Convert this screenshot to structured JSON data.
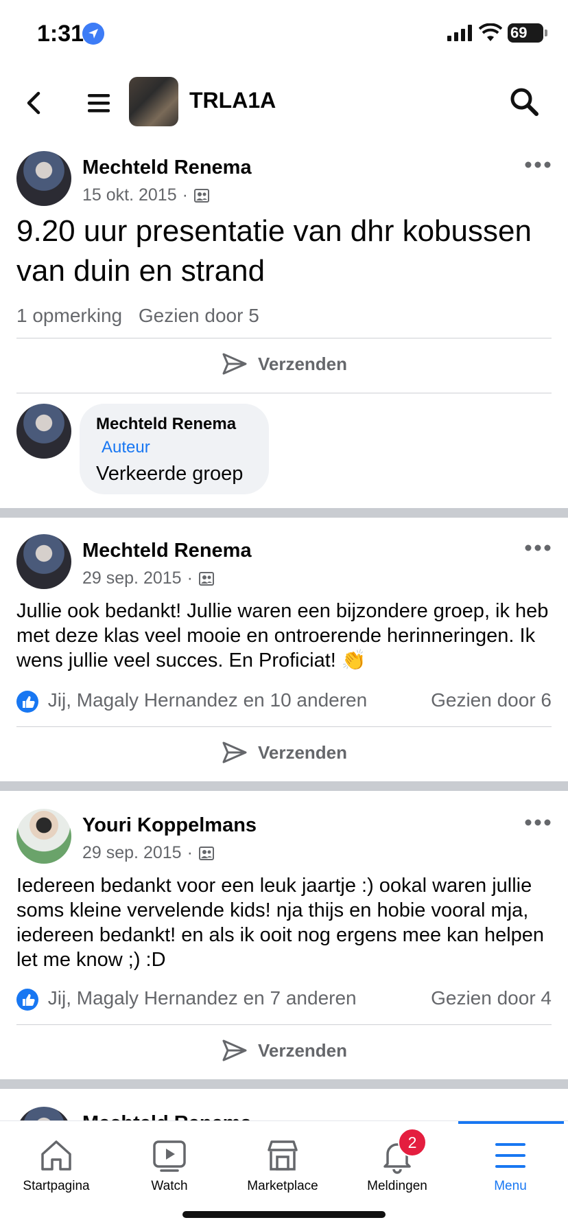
{
  "status_bar": {
    "time": "1:31",
    "battery": "69"
  },
  "header": {
    "title": "TRLA1A"
  },
  "posts": [
    {
      "author": "Mechteld Renema",
      "date": "15 okt. 2015",
      "dot": "·",
      "body": "9.20 uur presentatie van dhr kobussen van duin en strand",
      "comments": "1 opmerking",
      "seen": "Gezien door 5",
      "send_label": "Verzenden",
      "comment": {
        "author": "Mechteld Renema",
        "badge": "Auteur",
        "text": "Verkeerde groep"
      }
    },
    {
      "author": "Mechteld Renema",
      "date": "29 sep. 2015",
      "dot": "·",
      "body": "Jullie ook bedankt! Jullie waren een bijzondere groep, ik heb met deze klas veel mooie en ontroerende herinneringen. Ik wens jullie veel succes. En Proficiat! 👏",
      "reactions": "Jij, Magaly Hernandez en 10 anderen",
      "seen": "Gezien door 6",
      "send_label": "Verzenden"
    },
    {
      "author": "Youri Koppelmans",
      "date": "29 sep. 2015",
      "dot": "·",
      "body": "Iedereen bedankt voor een leuk jaartje :) ookal waren jullie soms kleine vervelende kids! nja thijs en hobie vooral mja, iedereen bedankt! en als ik ooit nog ergens mee kan helpen let me know ;) :D",
      "reactions": "Jij, Magaly Hernandez en 7 anderen",
      "seen": "Gezien door 4",
      "send_label": "Verzenden"
    },
    {
      "author": "Mechteld Renema"
    }
  ],
  "bottom_nav": {
    "items": [
      {
        "label": "Startpagina",
        "icon": "home-icon"
      },
      {
        "label": "Watch",
        "icon": "watch-icon"
      },
      {
        "label": "Marketplace",
        "icon": "marketplace-icon"
      },
      {
        "label": "Meldingen",
        "icon": "bell-icon",
        "badge": "2"
      },
      {
        "label": "Menu",
        "icon": "menu-icon",
        "active": true
      }
    ]
  },
  "colors": {
    "accent": "#1877f2",
    "badge": "#e41e3f",
    "secondary_text": "#65676b"
  }
}
